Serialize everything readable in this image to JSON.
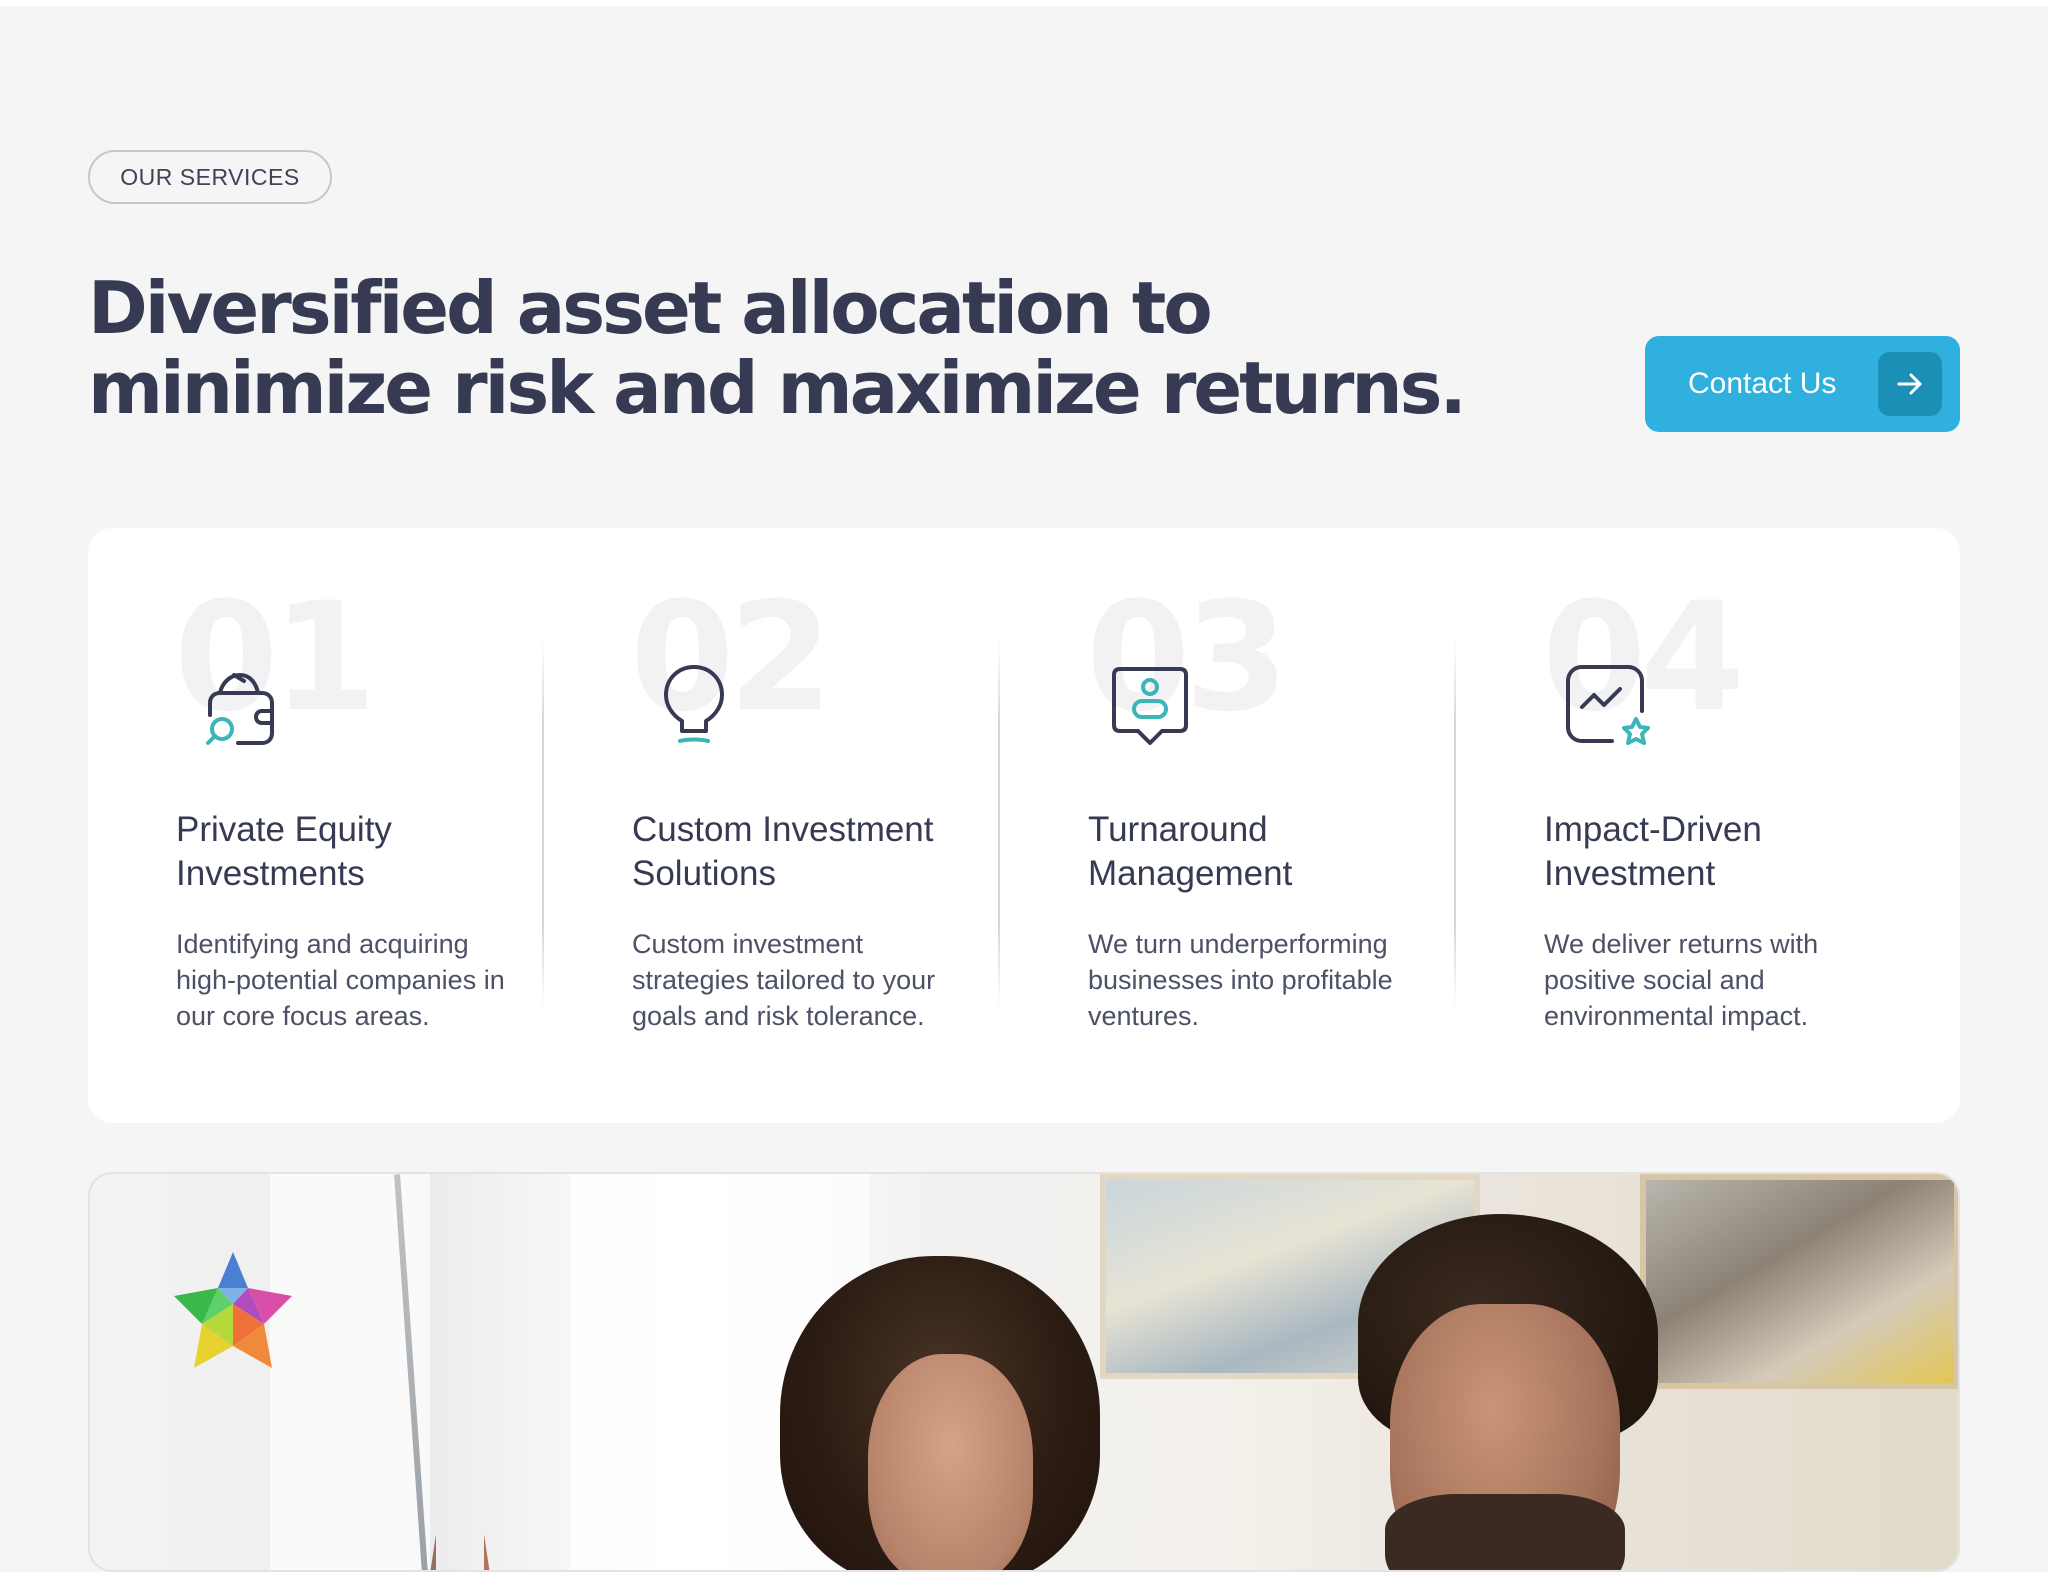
{
  "header": {
    "badge_label": "OUR SERVICES",
    "headline_line1": "Diversified asset allocation to",
    "headline_line2": "minimize risk and maximize returns.",
    "cta_label": "Contact Us"
  },
  "services": [
    {
      "number": "01",
      "icon": "wallet-search-icon",
      "title": "Private Equity Investments",
      "description": "Identifying and acquiring high-potential companies in our core focus areas."
    },
    {
      "number": "02",
      "icon": "lightbulb-icon",
      "title": "Custom Investment Solutions",
      "description": "Custom investment strategies tailored to your goals and risk tolerance."
    },
    {
      "number": "03",
      "icon": "user-badge-icon",
      "title": "Turnaround Management",
      "description": "We turn underperforming businesses into profitable ventures."
    },
    {
      "number": "04",
      "icon": "chart-star-icon",
      "title": "Impact-Driven Investment",
      "description": "We deliver returns with positive social and environmental impact."
    }
  ],
  "colors": {
    "background": "#f5f5f5",
    "text_primary": "#363a52",
    "accent": "#2fb0df",
    "accent_dark": "#1b8fb5",
    "icon_teal": "#3bb5b8"
  },
  "photo": {
    "icon": "star-logo-icon"
  }
}
